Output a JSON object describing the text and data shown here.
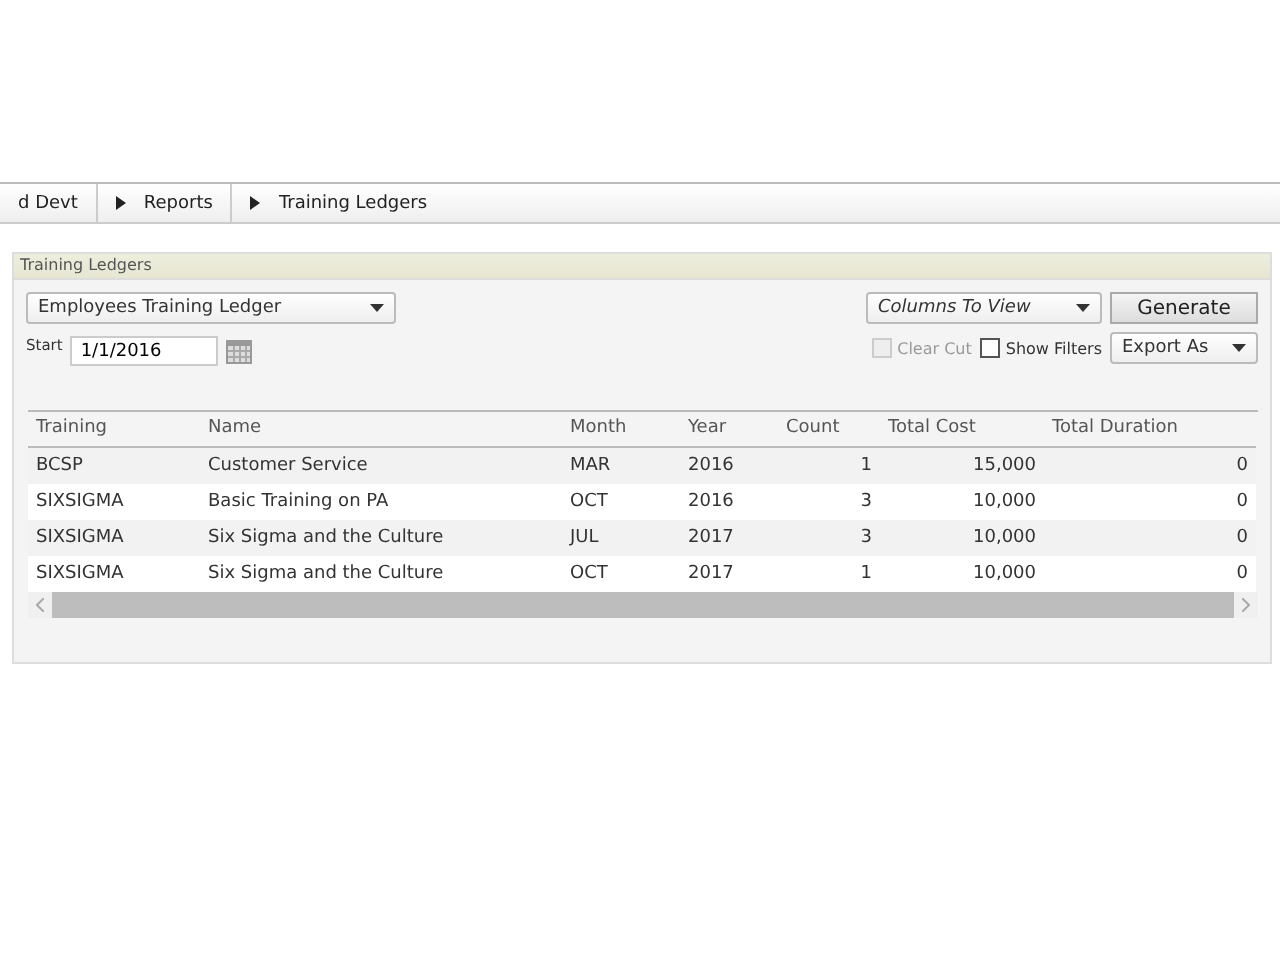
{
  "breadcrumbs": [
    {
      "label": "d Devt"
    },
    {
      "label": "Reports"
    },
    {
      "label": "Training Ledgers"
    }
  ],
  "panel": {
    "title": "Training Ledgers",
    "report_select": {
      "value": "Employees Training Ledger"
    },
    "start": {
      "label": "Start",
      "value": "1/1/2016"
    },
    "columns_select": {
      "value": "Columns To View"
    },
    "generate_button": "Generate",
    "clear_cut": {
      "label": "Clear Cut",
      "checked": false,
      "disabled": true
    },
    "show_filters": {
      "label": "Show Filters",
      "checked": false,
      "disabled": false
    },
    "export_select": {
      "value": "Export As"
    }
  },
  "table": {
    "columns": [
      "Training",
      "Name",
      "Month",
      "Year",
      "Count",
      "Total Cost",
      "Total Duration"
    ],
    "rows": [
      [
        "BCSP",
        "Customer Service",
        "MAR",
        "2016",
        "1",
        "15,000",
        "0"
      ],
      [
        "SIXSIGMA",
        "Basic Training on PA",
        "OCT",
        "2016",
        "3",
        "10,000",
        "0"
      ],
      [
        "SIXSIGMA",
        "Six Sigma and the Culture",
        "JUL",
        "2017",
        "3",
        "10,000",
        "0"
      ],
      [
        "SIXSIGMA",
        "Six Sigma and the Culture",
        "OCT",
        "2017",
        "1",
        "10,000",
        "0"
      ]
    ]
  }
}
